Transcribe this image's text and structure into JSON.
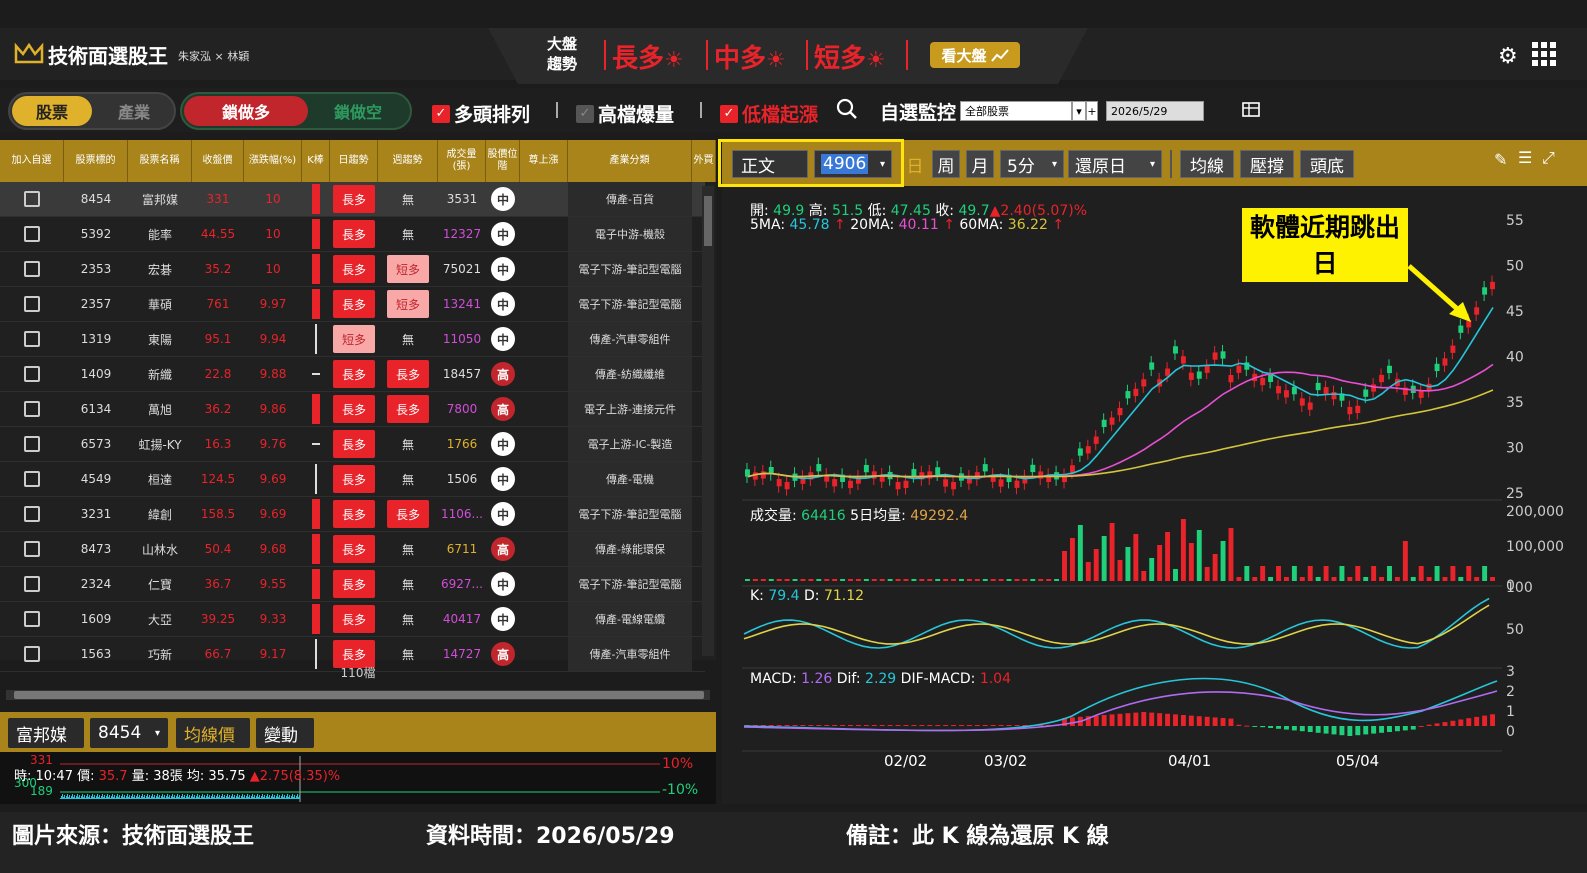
{
  "header": {
    "app_title": "技術面選股王",
    "authors": "朱家泓 × 林穎",
    "market_label": "大盤趨勢",
    "trends": [
      {
        "label": "長多"
      },
      {
        "label": "中多"
      },
      {
        "label": "短多"
      }
    ],
    "sun_glyph": "☀",
    "market_button": "看大盤"
  },
  "toolbar": {
    "toggle_stock": "股票",
    "toggle_industry": "產業",
    "toggle_lock_long": "鎖做多",
    "toggle_lock_short": "鎖做空",
    "filter_bull": "多頭排列",
    "filter_high": "高檔爆量",
    "filter_low": "低檔起漲",
    "watch_label": "自選監控",
    "watch_select": "全部股票",
    "date_select": "2026/5/29"
  },
  "table": {
    "headers": [
      "加入自選",
      "股票標的",
      "股票名稱",
      "收盤價",
      "漲跌幅(%)",
      "K棒",
      "日趨勢",
      "週趨勢",
      "成交量(張)",
      "股價位階",
      "尊上漲",
      "產業分類"
    ],
    "rows": [
      {
        "code": "8454",
        "name": "富邦媒",
        "close": "331",
        "chg": "10",
        "day": "長多",
        "week": "無",
        "vol": "3531",
        "pos": "中",
        "industry": "傳產-百貨"
      },
      {
        "code": "5392",
        "name": "能率",
        "close": "44.55",
        "chg": "10",
        "day": "長多",
        "week": "無",
        "vol": "12327",
        "pos": "中",
        "industry": "電子中游-機殼"
      },
      {
        "code": "2353",
        "name": "宏碁",
        "close": "35.2",
        "chg": "10",
        "day": "長多",
        "week": "短多",
        "vol": "75021",
        "pos": "中",
        "industry": "電子下游-筆記型電腦"
      },
      {
        "code": "2357",
        "name": "華碩",
        "close": "761",
        "chg": "9.97",
        "day": "長多",
        "week": "短多",
        "vol": "13241",
        "pos": "中",
        "industry": "電子下游-筆記型電腦"
      },
      {
        "code": "1319",
        "name": "東陽",
        "close": "95.1",
        "chg": "9.94",
        "day": "短多",
        "week": "無",
        "vol": "11050",
        "pos": "中",
        "industry": "傳產-汽車零組件"
      },
      {
        "code": "1409",
        "name": "新纖",
        "close": "22.8",
        "chg": "9.88",
        "day": "長多",
        "week": "長多",
        "vol": "18457",
        "pos": "高",
        "industry": "傳產-紡織纖維"
      },
      {
        "code": "6134",
        "name": "萬旭",
        "close": "36.2",
        "chg": "9.86",
        "day": "長多",
        "week": "長多",
        "vol": "7800",
        "pos": "高",
        "industry": "電子上游-連接元件"
      },
      {
        "code": "6573",
        "name": "虹揚-KY",
        "close": "16.3",
        "chg": "9.76",
        "day": "長多",
        "week": "無",
        "vol": "1766",
        "pos": "中",
        "industry": "電子上游-IC-製造"
      },
      {
        "code": "4549",
        "name": "桓達",
        "close": "124.5",
        "chg": "9.69",
        "day": "長多",
        "week": "無",
        "vol": "1506",
        "pos": "中",
        "industry": "傳產-電機"
      },
      {
        "code": "3231",
        "name": "緯創",
        "close": "158.5",
        "chg": "9.69",
        "day": "長多",
        "week": "長多",
        "vol": "1106...",
        "pos": "中",
        "industry": "電子下游-筆記型電腦"
      },
      {
        "code": "8473",
        "name": "山林水",
        "close": "50.4",
        "chg": "9.68",
        "day": "長多",
        "week": "無",
        "vol": "6711",
        "pos": "高",
        "industry": "傳產-綠能環保"
      },
      {
        "code": "2324",
        "name": "仁寶",
        "close": "36.7",
        "chg": "9.55",
        "day": "長多",
        "week": "無",
        "vol": "6927...",
        "pos": "中",
        "industry": "電子下游-筆記型電腦"
      },
      {
        "code": "1609",
        "name": "大亞",
        "close": "39.25",
        "chg": "9.33",
        "day": "長多",
        "week": "無",
        "vol": "40417",
        "pos": "中",
        "industry": "傳產-電線電纜"
      },
      {
        "code": "1563",
        "name": "巧新",
        "close": "66.7",
        "chg": "9.17",
        "day": "長多",
        "week": "無",
        "vol": "14727",
        "pos": "高",
        "industry": "傳產-汽車零組件"
      }
    ],
    "count": "110檔"
  },
  "detail": {
    "stock_name": "富邦媒",
    "stock_code": "8454",
    "btn_avg": "均線價",
    "btn_change": "變動",
    "intraday_info": "時: 10:47 價: ",
    "intraday_price": "35.7",
    "intraday_vol": " 量: 38張 均: 35.75 ",
    "intraday_chg": "▲2.75(8.35)%",
    "pct_up": "10%",
    "pct_down": "-10%",
    "left_top": "331",
    "left_mid": "300",
    "left_bot": "189"
  },
  "chart": {
    "stock_name": "正文",
    "stock_code": "4906",
    "period_day": "日",
    "period_week": "周",
    "period_month": "月",
    "period_min": "5分",
    "restore": "還原日",
    "btn_ma": "均線",
    "btn_pressure": "壓撐",
    "btn_head": "頭底",
    "ohlc_open_label": "開:",
    "ohlc_open": "49.9",
    "ohlc_high_label": "高:",
    "ohlc_high": "51.5",
    "ohlc_low_label": "低:",
    "ohlc_low": "47.45",
    "ohlc_close_label": "收:",
    "ohlc_close": "49.7",
    "ohlc_change": "▲2.40(5.07)%",
    "ma5_label": "5MA:",
    "ma5": "45.78",
    "ma20_label": "20MA:",
    "ma20": "40.11",
    "ma60_label": "60MA:",
    "ma60": "36.22",
    "up_arrow": "↑",
    "vol_label": "成交量:",
    "vol": "64416",
    "vol5_label": "5日均量:",
    "vol5": "49292.4",
    "k_label": "K:",
    "k": "79.4",
    "d_label": "D:",
    "d": "71.12",
    "macd_label": "MACD:",
    "macd": "1.26",
    "dif_label": "Dif:",
    "dif": "2.29",
    "difmacd_label": "DIF-MACD:",
    "difmacd": "1.04",
    "price_ticks": [
      "55",
      "50",
      "45",
      "40",
      "35",
      "30",
      "25"
    ],
    "vol_ticks": [
      "200,000",
      "100,000",
      "0"
    ],
    "kd_ticks": [
      "100",
      "50"
    ],
    "macd_ticks": [
      "3",
      "2",
      "1",
      "0"
    ],
    "date_ticks": [
      "02/02",
      "03/02",
      "04/01",
      "05/04"
    ],
    "annotation": "軟體近期跳出日"
  },
  "footer": {
    "source": "圖片來源：技術面選股王",
    "data_time": "資料時間：2026/05/29",
    "note": "備註：此 K 線為還原 K 線"
  },
  "colors": {
    "accent": "#a8841a",
    "up": "#e8232a",
    "down": "#1fcf7a",
    "ma5": "#26c6da",
    "ma20": "#e94fd4",
    "ma60": "#d4c43c",
    "annotation": "#fff200"
  }
}
